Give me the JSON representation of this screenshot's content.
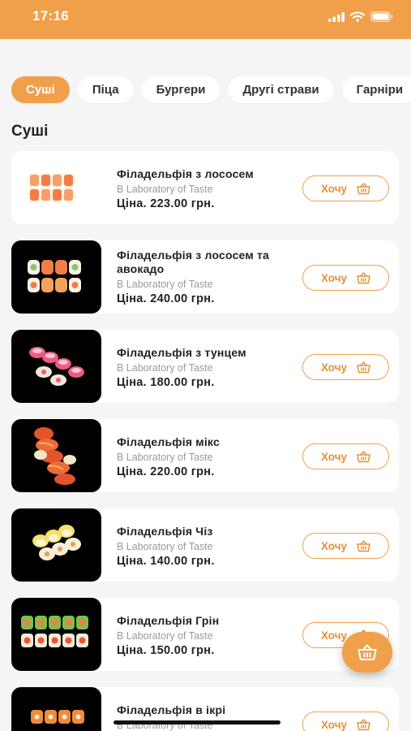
{
  "status": {
    "time": "17:16"
  },
  "tabs": [
    {
      "label": "Суші",
      "active": true
    },
    {
      "label": "Піца",
      "active": false
    },
    {
      "label": "Бургери",
      "active": false
    },
    {
      "label": "Другі страви",
      "active": false
    },
    {
      "label": "Гарніри",
      "active": false
    }
  ],
  "section_title": "Суші",
  "want_label": "Хочу",
  "products": [
    {
      "name": "Філадельфія з лососем",
      "vendor": "B Laboratory of Taste",
      "price": "Ціна. 223.00 грн."
    },
    {
      "name": "Філадельфія з лососем та авокадо",
      "vendor": "B Laboratory of Taste",
      "price": "Ціна. 240.00 грн."
    },
    {
      "name": "Філадельфія з тунцем",
      "vendor": "B Laboratory of Taste",
      "price": "Ціна. 180.00 грн."
    },
    {
      "name": "Філадельфія мікс",
      "vendor": "B Laboratory of Taste",
      "price": "Ціна. 220.00 грн."
    },
    {
      "name": "Філадельфія Чіз",
      "vendor": "B Laboratory of Taste",
      "price": "Ціна. 140.00 грн."
    },
    {
      "name": "Філадельфія Грін",
      "vendor": "B Laboratory of Taste",
      "price": "Ціна. 150.00 грн."
    },
    {
      "name": "Філадельфія в ікрі",
      "vendor": "B Laboratory of Taste",
      "price": ""
    }
  ],
  "colors": {
    "accent": "#f0a04a",
    "accent_text": "#e39238",
    "background": "#f5f5f5",
    "card": "#ffffff"
  },
  "icons": {
    "basket": "basket-icon",
    "cart_fab": "cart-icon"
  }
}
